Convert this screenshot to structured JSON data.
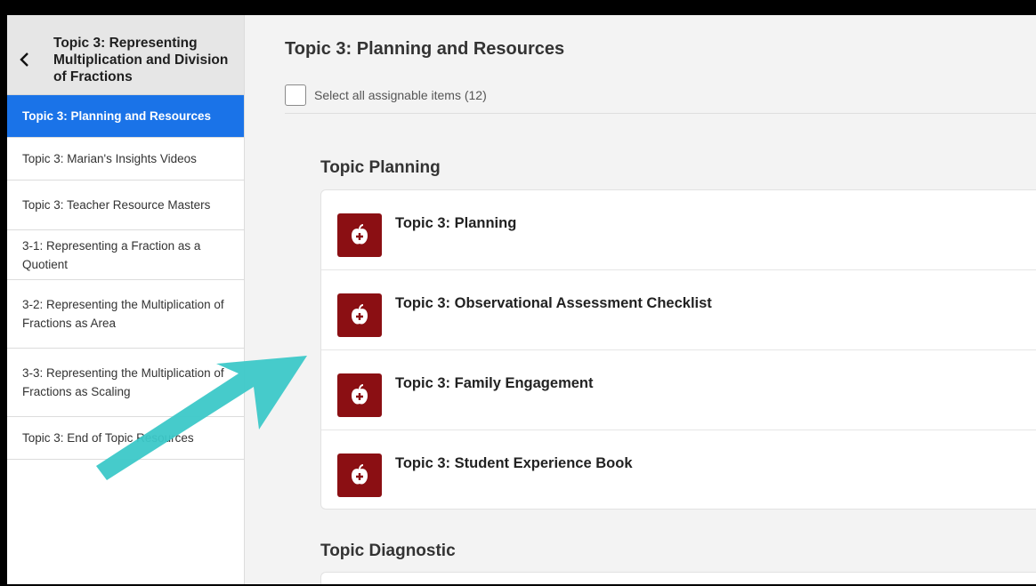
{
  "sidebar": {
    "title": "Topic 3: Representing Multiplication and Division of Fractions",
    "items": [
      {
        "label": "Topic 3: Planning and Resources"
      },
      {
        "label": "Topic 3: Marian's Insights Videos"
      },
      {
        "label": "Topic 3: Teacher Resource Masters"
      },
      {
        "label": "3-1: Representing a Fraction as a Quotient"
      },
      {
        "label": "3-2: Representing the Multiplication of Fractions as Area"
      },
      {
        "label": "3-3: Representing the Multiplication of Fractions as Scaling"
      },
      {
        "label": "Topic 3: End of Topic Resources"
      }
    ]
  },
  "main": {
    "title": "Topic 3: Planning and Resources",
    "select_all_label": "Select all assignable items (12)",
    "sections": [
      {
        "title": "Topic Planning",
        "items": [
          {
            "label": "Topic 3: Planning",
            "icon": "apple-plus-icon"
          },
          {
            "label": "Topic 3: Observational Assessment Checklist",
            "icon": "apple-plus-icon"
          },
          {
            "label": "Topic 3: Family Engagement",
            "icon": "apple-plus-icon"
          },
          {
            "label": "Topic 3: Student Experience Book",
            "icon": "apple-plus-icon"
          }
        ]
      },
      {
        "title": "Topic Diagnostic",
        "items": []
      }
    ]
  },
  "colors": {
    "active_nav": "#1a73e8",
    "resource_icon_bg": "#8b0f13",
    "annotation_arrow": "#3cc8c8"
  }
}
